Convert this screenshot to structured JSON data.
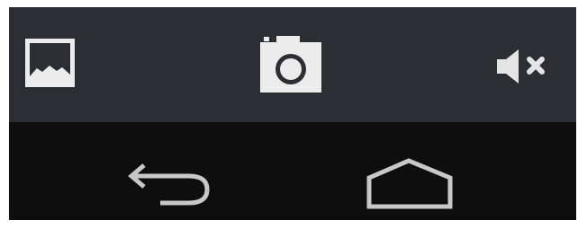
{
  "camera_controls": {
    "items": [
      {
        "id": "gallery",
        "icon": "gallery-image-icon"
      },
      {
        "id": "shutter",
        "icon": "camera-icon"
      },
      {
        "id": "sound",
        "icon": "volume-muted-icon",
        "state": "muted"
      }
    ]
  },
  "system_nav": {
    "items": [
      {
        "id": "back",
        "icon": "back-arrow-icon"
      },
      {
        "id": "home",
        "icon": "home-icon"
      }
    ]
  },
  "colors": {
    "action_bar_bg": "#2b2e33",
    "nav_bar_bg": "#0e0e0f",
    "icon_light": "#eeeeee",
    "nav_icon": "#c8c8c8"
  }
}
